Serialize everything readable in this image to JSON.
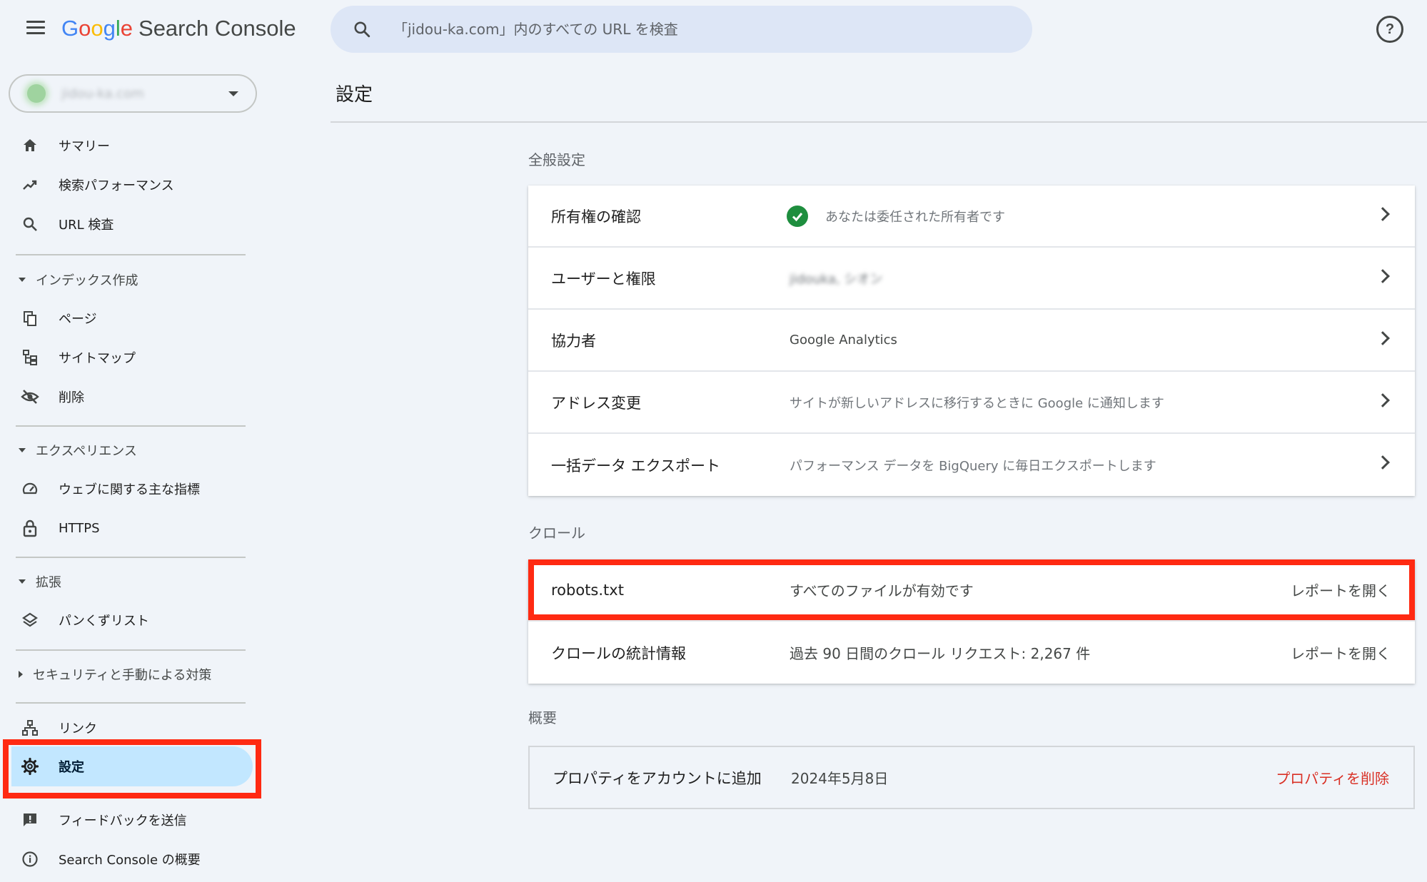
{
  "app": {
    "logo_google": [
      "G",
      "o",
      "o",
      "g",
      "l",
      "e"
    ],
    "logo_product": "Search Console",
    "search_placeholder": "「jidou-ka.com」内のすべての URL を検査"
  },
  "property": {
    "name": "jidou-ka.com"
  },
  "nav": {
    "summary": "サマリー",
    "performance": "検索パフォーマンス",
    "url_inspection": "URL 検査",
    "index_section": "インデックス作成",
    "pages": "ページ",
    "sitemaps": "サイトマップ",
    "removals": "削除",
    "experience_section": "エクスペリエンス",
    "web_vitals": "ウェブに関する主な指標",
    "https": "HTTPS",
    "enhancements_section": "拡張",
    "breadcrumbs": "パンくずリスト",
    "security_section": "セキュリティと手動による対策",
    "links": "リンク",
    "settings": "設定",
    "feedback": "フィードバックを送信",
    "about": "Search Console の概要"
  },
  "page": {
    "title": "設定",
    "general": {
      "title": "全般設定",
      "rows": [
        {
          "label": "所有権の確認",
          "value": "あなたは委任された所有者です"
        },
        {
          "label": "ユーザーと権限",
          "value": "jidouka, シオン"
        },
        {
          "label": "協力者",
          "value": "Google Analytics"
        },
        {
          "label": "アドレス変更",
          "value": "サイトが新しいアドレスに移行するときに Google に通知します"
        },
        {
          "label": "一括データ エクスポート",
          "value": "パフォーマンス データを BigQuery に毎日エクスポートします"
        }
      ]
    },
    "crawl": {
      "title": "クロール",
      "rows": [
        {
          "label": "robots.txt",
          "value": "すべてのファイルが有効です",
          "action": "レポートを開く"
        },
        {
          "label": "クロールの統計情報",
          "value": "過去 90 日間のクロール リクエスト: 2,267 件",
          "action": "レポートを開く"
        }
      ]
    },
    "about": {
      "title": "概要",
      "rows": [
        {
          "label": "プロパティをアカウントに追加",
          "value": "2024年5月8日",
          "action": "プロパティを削除"
        }
      ]
    }
  },
  "colors": {
    "accent_selected": "#c2e7ff",
    "highlight_box": "#ff2a12",
    "ok_green": "#1e8e3e",
    "danger": "#d93025"
  }
}
